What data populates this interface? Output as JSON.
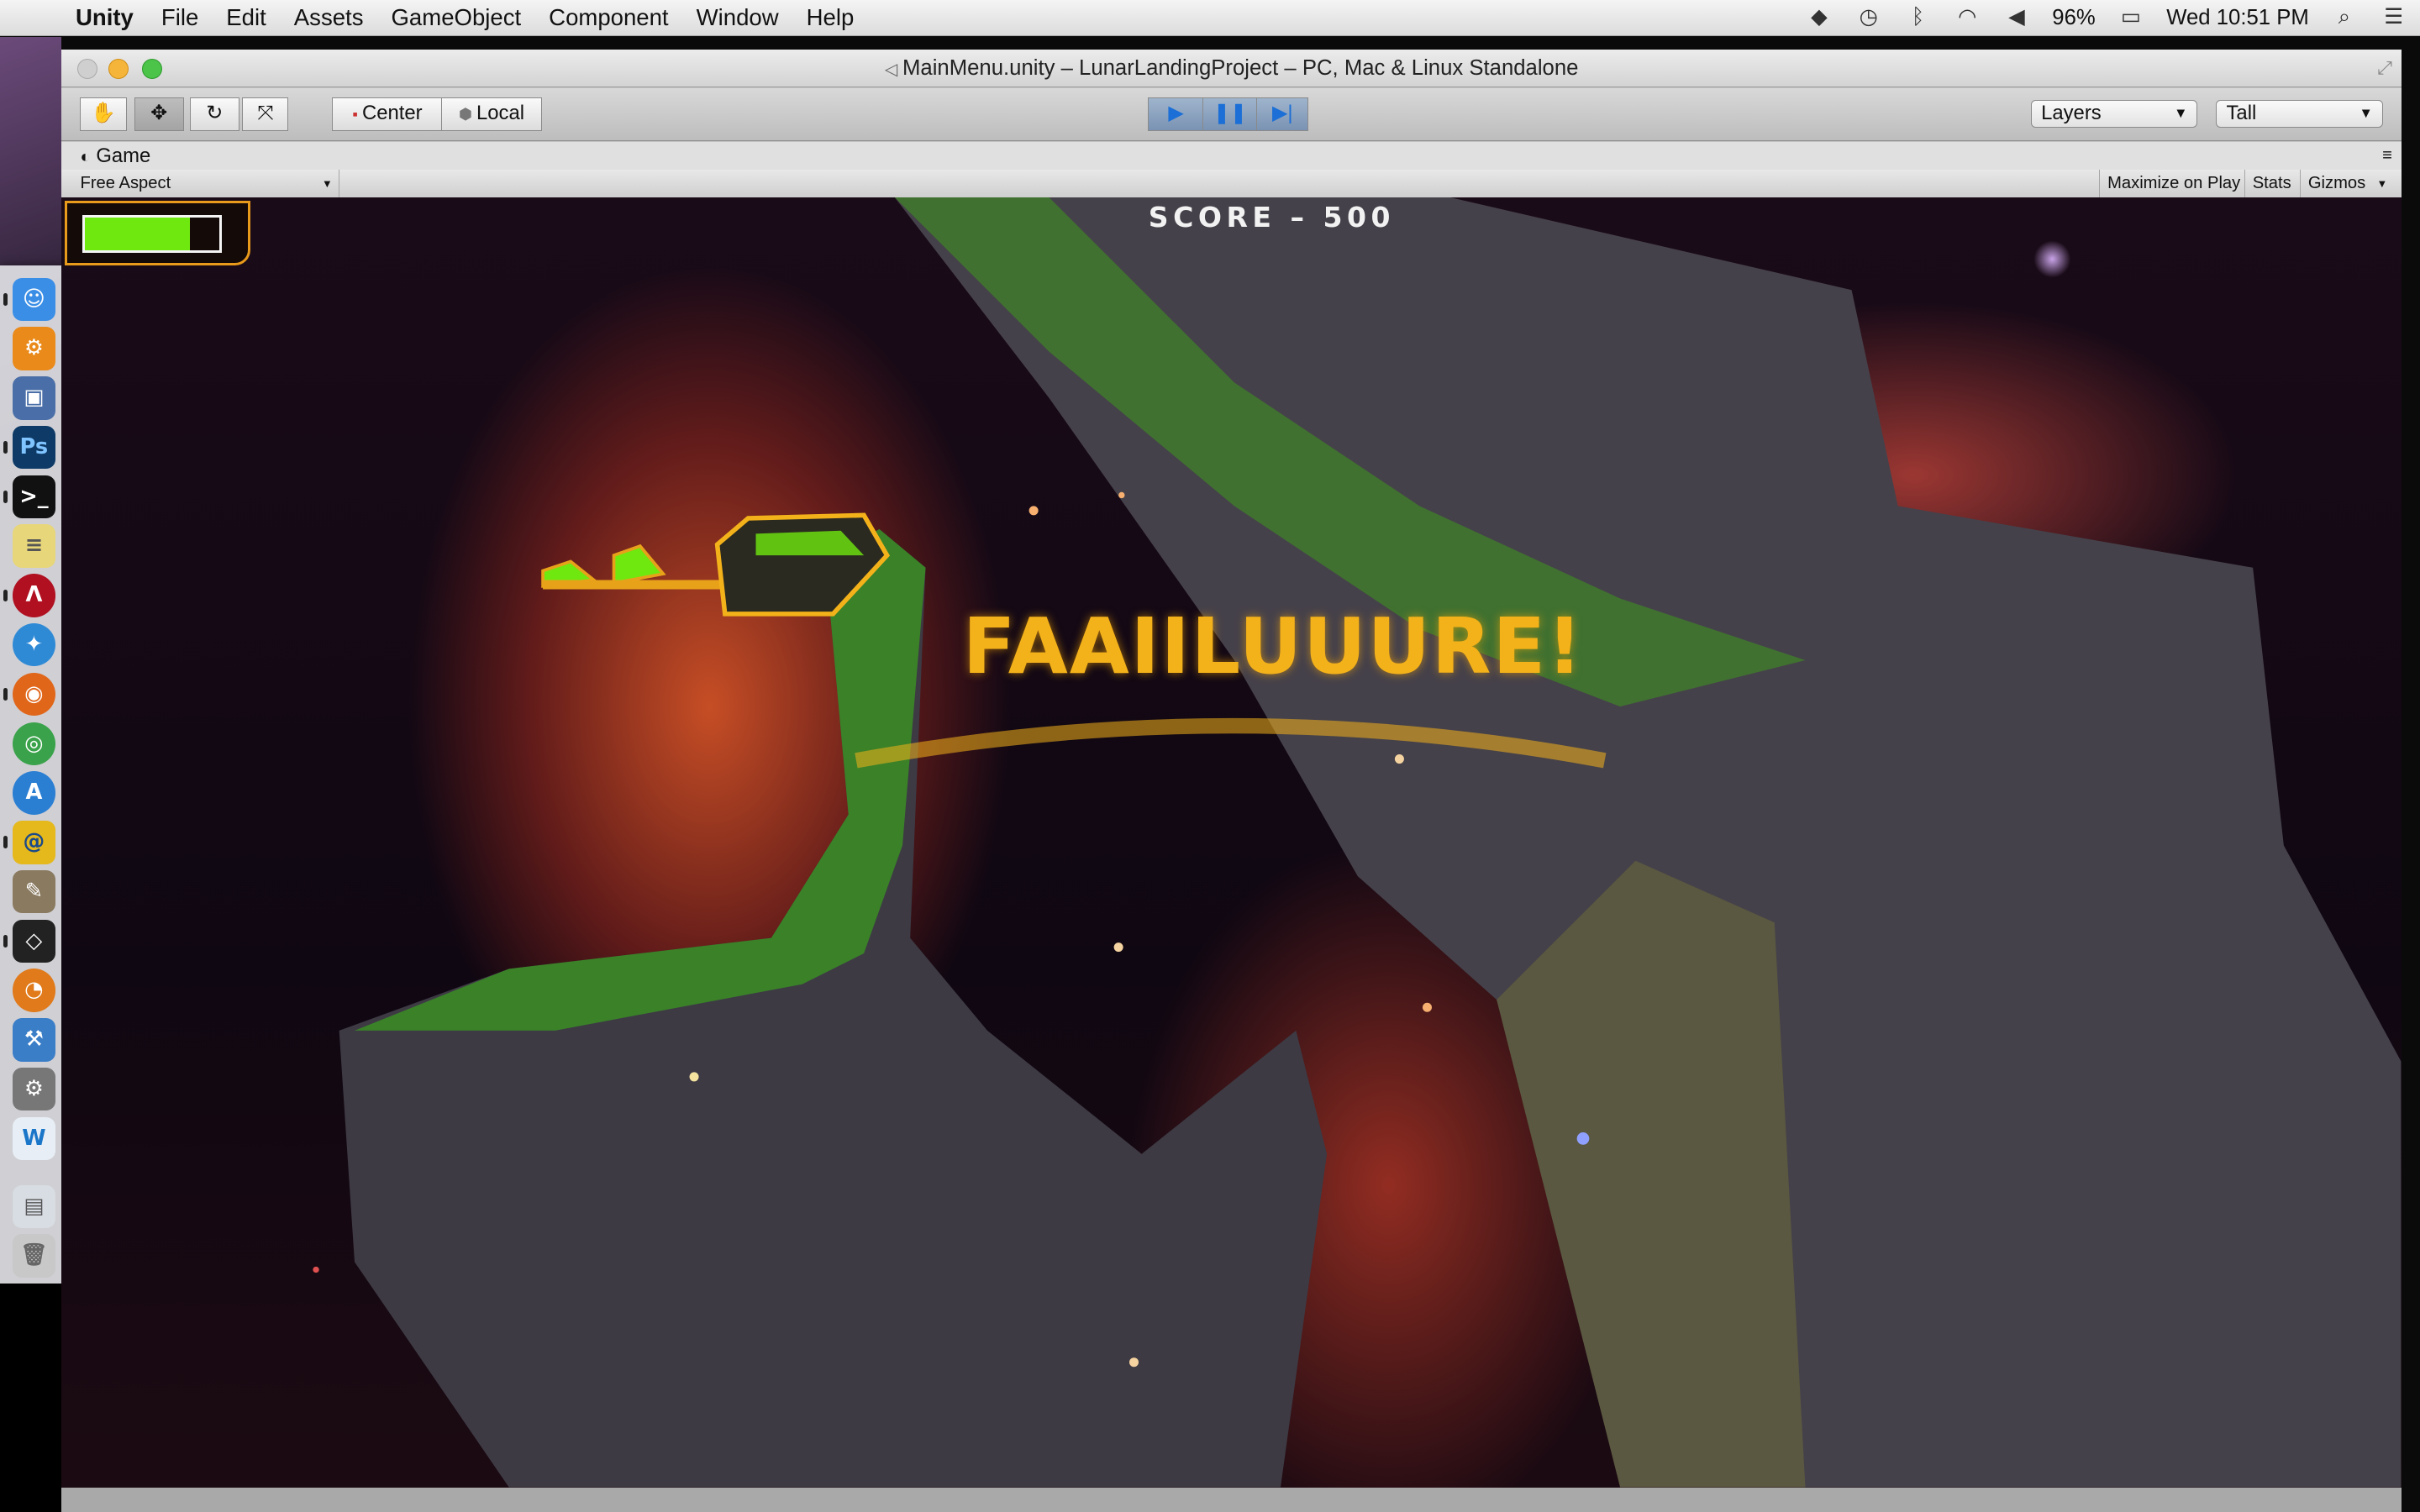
{
  "menubar": {
    "app": "Unity",
    "items": [
      "File",
      "Edit",
      "Assets",
      "GameObject",
      "Component",
      "Window",
      "Help"
    ],
    "battery": "96%",
    "clock": "Wed 10:51 PM"
  },
  "window": {
    "title": "MainMenu.unity – LunarLandingProject – PC, Mac & Linux Standalone"
  },
  "toolbar": {
    "pivot_center": "Center",
    "pivot_local": "Local",
    "layers": "Layers",
    "layout": "Tall"
  },
  "game_tab": {
    "label": "Game",
    "aspect": "Free Aspect",
    "maximize_on_play": "Maximize on Play",
    "stats": "Stats",
    "gizmos": "Gizmos"
  },
  "game": {
    "score": "SCORE – 500",
    "message": "FAAIILUUURE!",
    "fuel_fraction": 0.78,
    "colors": {
      "message": "#f4b21a",
      "fuel": "#6fe80f",
      "hud_frame": "#e89a1a"
    }
  },
  "dock": {
    "icons": [
      "finder-icon",
      "system-preferences-icon",
      "monitor-icon",
      "photoshop-icon",
      "terminal-icon",
      "stickies-icon",
      "textmate-icon",
      "safari-icon",
      "firefox-icon",
      "chrome-icon",
      "app-store-icon",
      "cyberduck-icon",
      "gimp-icon",
      "unity-icon",
      "blender-icon",
      "xcode-icon",
      "disk-utility-icon",
      "wordpress-icon",
      "downloads-icon",
      "trash-icon"
    ]
  }
}
